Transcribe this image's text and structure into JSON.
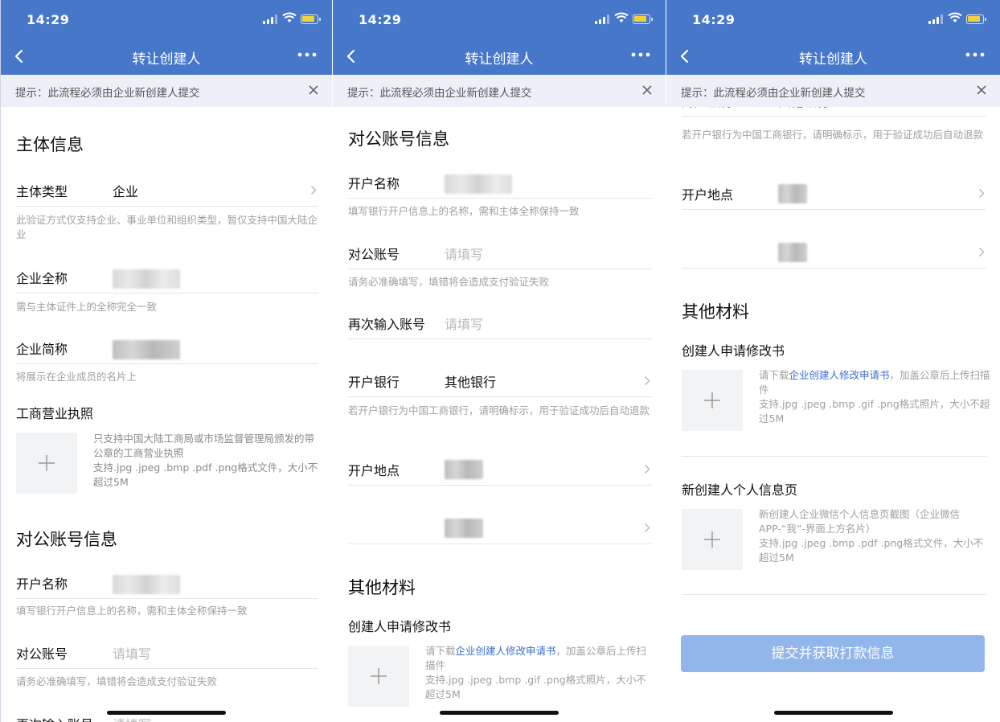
{
  "status": {
    "time": "14:29"
  },
  "nav": {
    "title": "转让创建人"
  },
  "tip": {
    "text": "提示：此流程必须由企业新创建人提交"
  },
  "subject": {
    "title": "主体信息",
    "type_label": "主体类型",
    "type_value": "企业",
    "type_hint": "此验证方式仅支持企业、事业单位和组织类型，暂仅支持中国大陆企业",
    "fullname_label": "企业全称",
    "fullname_hint": "需与主体证件上的全称完全一致",
    "shortname_label": "企业简称",
    "shortname_hint": "将展示在企业成员的名片上",
    "license_title": "工商营业执照",
    "license_desc": "只支持中国大陆工商局或市场监督管理局颁发的带公章的工商营业执照",
    "license_format": "支持.jpg .jpeg .bmp .pdf .png格式文件，大小不超过5M"
  },
  "account": {
    "title": "对公账号信息",
    "name_label": "开户名称",
    "name_hint": "填写银行开户信息上的名称，需和主体全称保持一致",
    "number_label": "对公账号",
    "number_placeholder": "请填写",
    "number_hint": "请务必准确填写，填错将会造成支付验证失败",
    "confirm_label": "再次输入账号",
    "confirm_placeholder": "请填写",
    "bank_label": "开户银行",
    "bank_value": "其他银行",
    "bank_hint": "若开户银行为中国工商银行，请明确标示，用于验证成功后自动退款",
    "location_label": "开户地点"
  },
  "materials": {
    "title": "其他材料",
    "letter_title": "创建人申请修改书",
    "letter_desc_pre": "请下载",
    "letter_link": "企业创建人修改申请书",
    "letter_desc_post": "，加盖公章后上传扫描件",
    "letter_format": "支持.jpg .jpeg .bmp .gif .png格式照片，大小不超过5M",
    "profile_title": "新创建人个人信息页",
    "profile_desc": "新创建人企业微信个人信息页截图（企业微信APP-“我”-界面上方名片）",
    "profile_format": "支持.jpg .jpeg .bmp .pdf .png格式文件，大小不超过5M"
  },
  "submit": {
    "label": "提交并获取打款信息"
  },
  "colors": {
    "header": "#4777c9",
    "tip_bg": "#edf1f7",
    "link": "#3c6ed0",
    "submit": "#93b6ea",
    "upload_bg": "#f2f3f5"
  },
  "icons": [
    "back-arrow-icon",
    "more-dots-icon",
    "close-icon",
    "chevron-right-icon",
    "plus-icon",
    "signal-icon",
    "wifi-icon",
    "battery-icon"
  ]
}
